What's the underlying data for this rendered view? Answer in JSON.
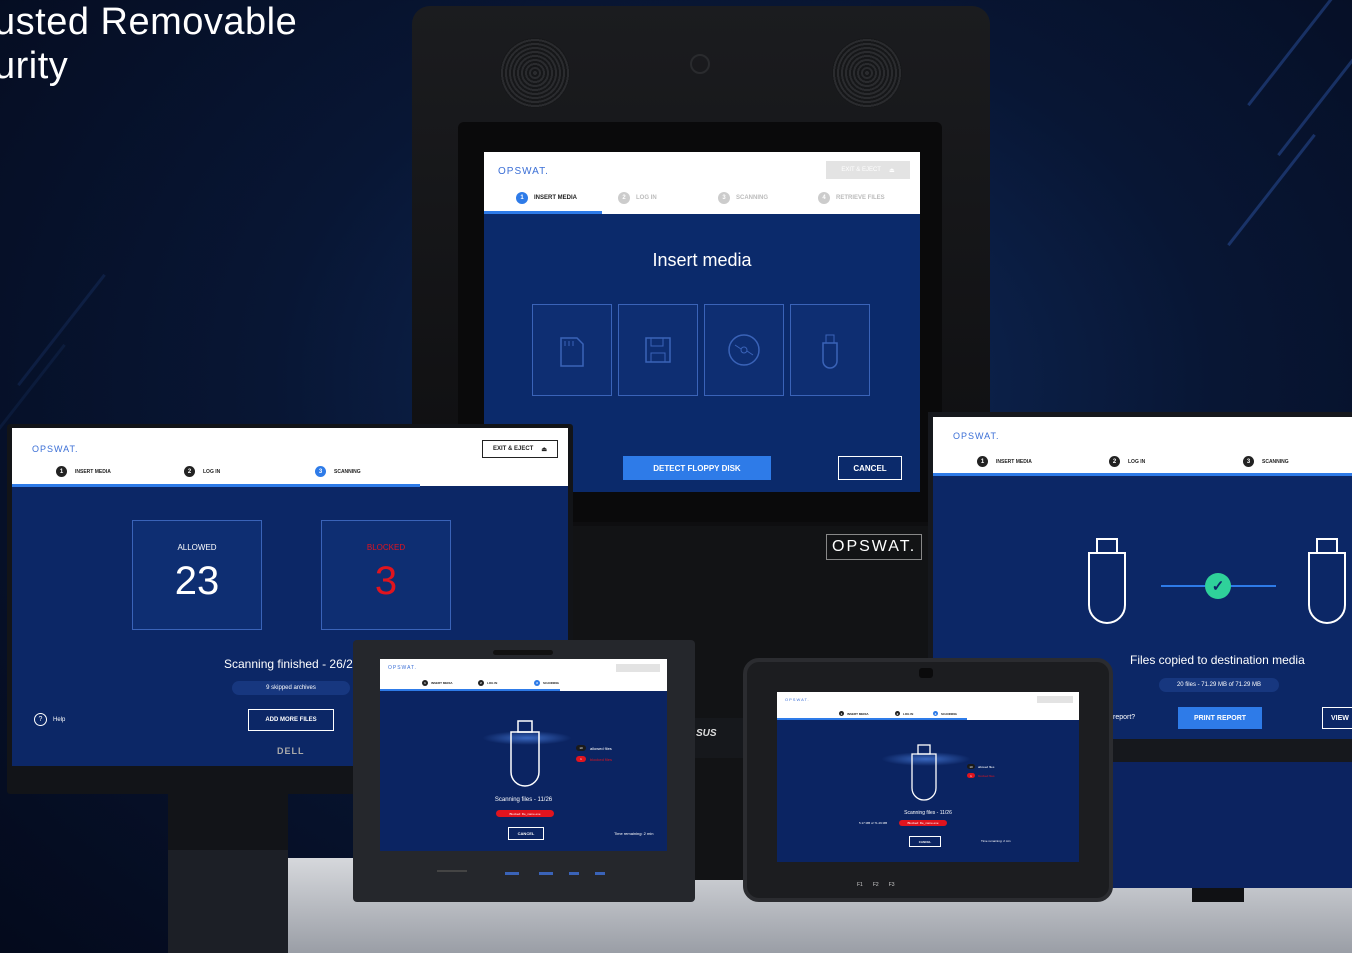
{
  "headline": {
    "line1": "usted Removable",
    "line2": "urity"
  },
  "brand": {
    "logo": "OPSWAT.",
    "device_logo": "OPSWAT."
  },
  "kiosk": {
    "exit_label": "EXIT & EJECT",
    "steps": [
      {
        "num": "1",
        "label": "INSERT MEDIA"
      },
      {
        "num": "2",
        "label": "LOG IN"
      },
      {
        "num": "3",
        "label": "SCANNING"
      },
      {
        "num": "4",
        "label": "RETRIEVE FILES"
      }
    ],
    "title": "Insert media",
    "media_icons": [
      "sd-card-icon",
      "floppy-disk-icon",
      "optical-disc-icon",
      "usb-drive-icon"
    ],
    "detect_label": "DETECT FLOPPY DISK",
    "cancel_label": "CANCEL"
  },
  "dell": {
    "exit_label": "EXIT & EJECT",
    "steps": [
      {
        "num": "1",
        "label": "INSERT MEDIA"
      },
      {
        "num": "2",
        "label": "LOG IN"
      },
      {
        "num": "3",
        "label": "SCANNING"
      }
    ],
    "allowed_label": "ALLOWED",
    "allowed_value": "23",
    "blocked_label": "BLOCKED",
    "blocked_value": "3",
    "status": "Scanning finished - 26/2",
    "skipped": "9 skipped archives",
    "add_label": "ADD MORE FILES",
    "help_label": "Help",
    "vendor": "DELL"
  },
  "right_monitor": {
    "steps": [
      {
        "num": "1",
        "label": "INSERT MEDIA"
      },
      {
        "num": "2",
        "label": "LOG IN"
      },
      {
        "num": "3",
        "label": "SCANNING"
      }
    ],
    "copied_text": "Files copied to destination media",
    "files_info": "20 files - 71.29 MB of 71.29 MB",
    "report_question": "report?",
    "print_label": "PRINT REPORT",
    "view_label": "VIEW"
  },
  "tablet_left": {
    "steps": [
      {
        "num": "1",
        "label": "INSERT MEDIA"
      },
      {
        "num": "2",
        "label": "LOG IN"
      },
      {
        "num": "3",
        "label": "SCANNING"
      }
    ],
    "allowed_count": "10",
    "allowed_label": "allowed files",
    "blocked_count": "1",
    "blocked_label": "blocked files",
    "scan_text": "Scanning files - 11/26",
    "blocked_file": "Blocked: file_name.exe",
    "cancel_label": "CANCEL",
    "time_remaining": "Time remaining: 2 min",
    "vendor": "SUS"
  },
  "tablet_right": {
    "steps": [
      {
        "num": "1",
        "label": "INSERT MEDIA"
      },
      {
        "num": "2",
        "label": "LOG IN"
      },
      {
        "num": "3",
        "label": "SCANNING"
      }
    ],
    "allowed_count": "10",
    "allowed_label": "allowed files",
    "blocked_count": "1",
    "blocked_label": "blocked files",
    "scan_text": "Scanning files - 11/26",
    "size_text": "5.17 MB of 71.29 MB",
    "blocked_file": "Blocked: file_name.exe",
    "cancel_label": "CANCEL",
    "time_remaining": "Time remaining: 2 min",
    "keys": [
      "F1",
      "F2",
      "F3"
    ]
  },
  "colors": {
    "accent": "#2e7be8",
    "blocked": "#e0141e",
    "screen": "#0b2a6b",
    "success": "#2fd19a"
  }
}
